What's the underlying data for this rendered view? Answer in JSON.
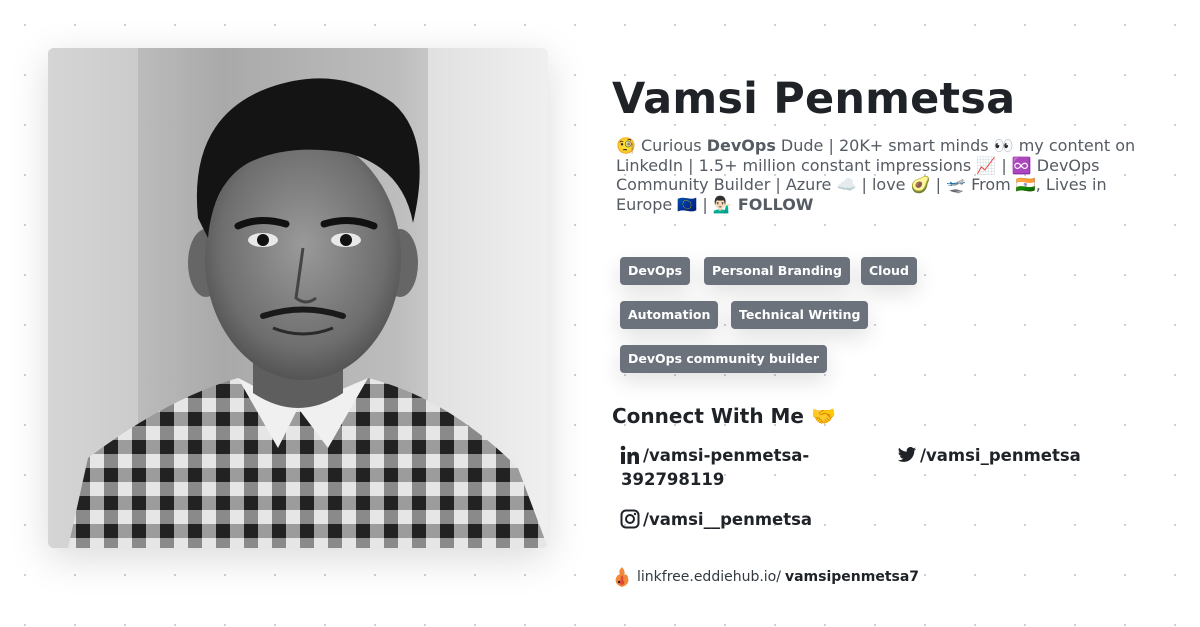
{
  "profile": {
    "name": "Vamsi Penmetsa",
    "bio": {
      "emoji_curious": "🧐",
      "text1": " Curious ",
      "bold1": "DevOps",
      "text2": " Dude | 20K+ smart minds 👀 my content on LinkedIn | 1.5+ million constant impressions 📈 | ♾️ DevOps Community Builder | Azure ☁️ | love 🥑 | 🛫 From 🇮🇳, Lives in Europe 🇪🇺 | 💁🏻‍♂️ ",
      "bold2": "FOLLOW"
    }
  },
  "tags": [
    "DevOps",
    "Personal Branding",
    "Cloud",
    "Automation",
    "Technical Writing",
    "DevOps community builder"
  ],
  "connect": {
    "title": "Connect With Me 🤝",
    "linkedin_line1": "/vamsi-penmetsa-",
    "linkedin_line2": "392798119",
    "twitter": "/vamsi_penmetsa",
    "instagram": "/vamsi__penmetsa"
  },
  "footer": {
    "prefix": "linkfree.eddiehub.io/",
    "username": "vamsipenmetsa7"
  },
  "colors": {
    "tag_bg": "#6b727b",
    "text_dark": "#1f2328",
    "text_muted": "#555b63"
  }
}
